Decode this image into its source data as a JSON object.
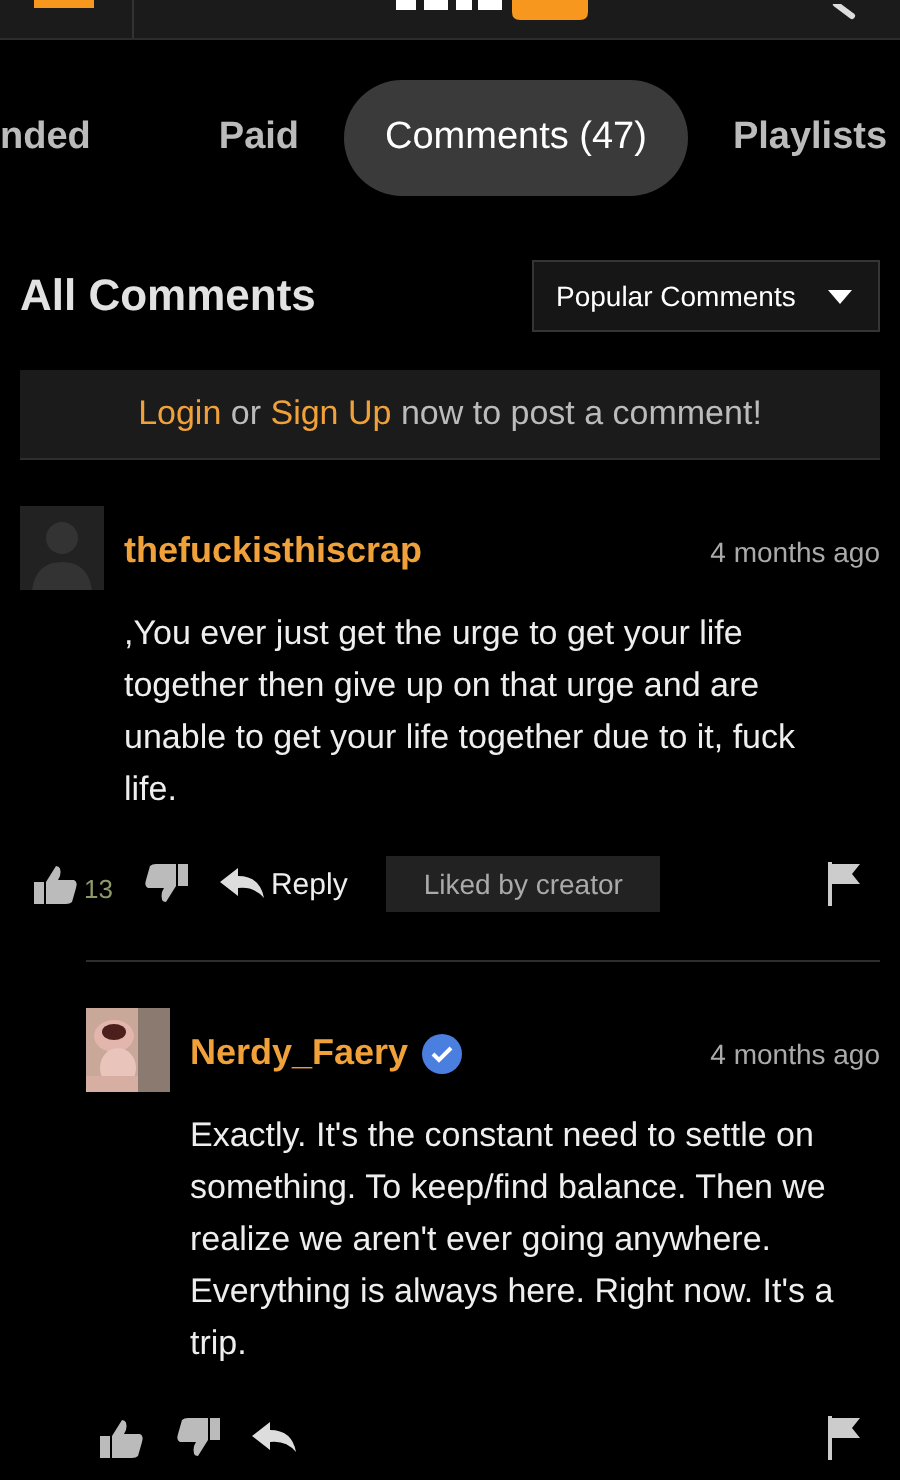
{
  "tabs": [
    {
      "label": "nded",
      "selected": false
    },
    {
      "label": "Paid",
      "selected": false
    },
    {
      "label": "Comments (47)",
      "selected": true
    },
    {
      "label": "Playlists",
      "selected": false
    }
  ],
  "heading": "All Comments",
  "sort_dropdown": {
    "value": "Popular Comments"
  },
  "login_prompt": {
    "login": "Login",
    "or": "or",
    "signup": "Sign Up",
    "rest": "now to post a comment!"
  },
  "comments": [
    {
      "username": "thefuckisthiscrap",
      "verified": false,
      "avatar": {
        "kind": "silhouette"
      },
      "time": "4 months ago",
      "text": ",You ever just get the urge to get your life together then give up on that urge and are unable to get your life together due to it, fuck life.",
      "likes": "13",
      "reply": "Reply",
      "badge": "Liked by creator",
      "children": [
        {
          "username": "Nerdy_Faery",
          "verified": true,
          "time": "4 months ago",
          "text": "Exactly. It's the constant need to settle on something. To keep/find balance. Then we realize we aren't ever going anywhere. Everything is always here. Right now. It's a trip."
        }
      ]
    }
  ]
}
